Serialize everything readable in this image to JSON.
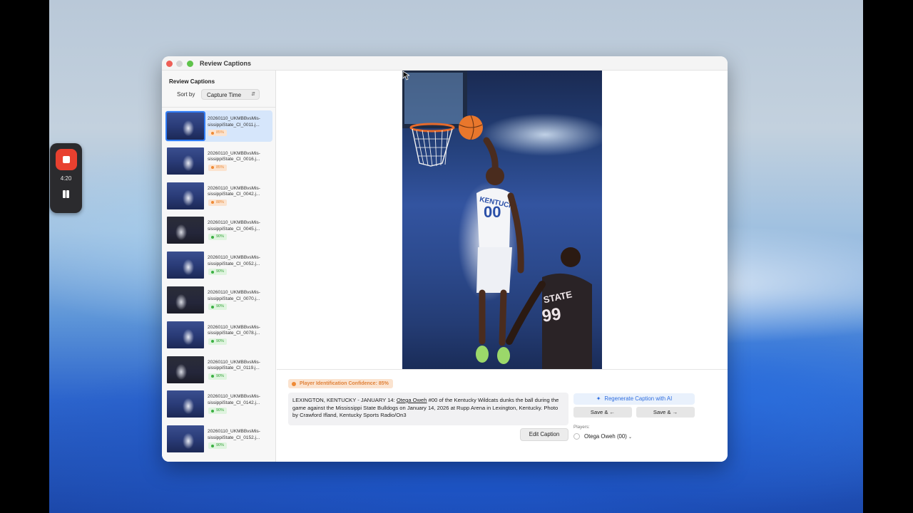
{
  "recorder": {
    "time": "4:20"
  },
  "window": {
    "title": "Review Captions"
  },
  "sidebar": {
    "heading": "Review Captions",
    "sort_label": "Sort by",
    "sort_value": "Capture Time",
    "items": [
      {
        "line1": "20260110_UKMBBvsMis-",
        "line2": "sissippiState_CI_0011.j...",
        "confidence": "85%",
        "level": "orange",
        "selected": true
      },
      {
        "line1": "20260110_UKMBBvsMis-",
        "line2": "sissippiState_CI_0016.j...",
        "confidence": "85%",
        "level": "orange"
      },
      {
        "line1": "20260110_UKMBBvsMis-",
        "line2": "sissippiState_CI_0042.j...",
        "confidence": "88%",
        "level": "orange"
      },
      {
        "line1": "20260110_UKMBBvsMis-",
        "line2": "sissippiState_CI_0045.j...",
        "confidence": "90%",
        "level": "green"
      },
      {
        "line1": "20260110_UKMBBvsMis-",
        "line2": "sissippiState_CI_0052.j...",
        "confidence": "90%",
        "level": "green"
      },
      {
        "line1": "20260110_UKMBBvsMis-",
        "line2": "sissippiState_CI_0070.j...",
        "confidence": "90%",
        "level": "green"
      },
      {
        "line1": "20260110_UKMBBvsMis-",
        "line2": "sissippiState_CI_0078.j...",
        "confidence": "90%",
        "level": "green"
      },
      {
        "line1": "20260110_UKMBBvsMis-",
        "line2": "sissippiState_CI_0119.j...",
        "confidence": "90%",
        "level": "green"
      },
      {
        "line1": "20260110_UKMBBvsMis-",
        "line2": "sissippiState_CI_0142.j...",
        "confidence": "90%",
        "level": "green"
      },
      {
        "line1": "20260110_UKMBBvsMis-",
        "line2": "sissippiState_CI_0152.j...",
        "confidence": "90%",
        "level": "green"
      }
    ]
  },
  "main": {
    "confidence_pill": "Player Identification Confidence: 85%",
    "caption": {
      "before": "LEXINGTON, KENTUCKY - JANUARY 14: ",
      "player_name": "Otega Oweh",
      "after": " #00 of the Kentucky Wildcats dunks the ball during the game against the Mississippi State Bulldogs on January 14, 2026 at Rupp Arena in Lexington, Kentucky. Photo by Crawford Ifland, Kentucky Sports Radio/On3"
    },
    "edit_button": "Edit Caption",
    "regenerate_button": "Regenerate Caption with AI",
    "save_prev_button": "Save & ←",
    "save_next_button": "Save & →",
    "players_label": "Players:",
    "player": "Otega Oweh (00)",
    "photo": {
      "jersey_front_text": "KENTUCKY",
      "jersey_front_number": "00",
      "jersey_back_text": "STATE",
      "jersey_back_number": "99"
    }
  },
  "colors": {
    "accent": "#2f7cf6",
    "confidence_orange": "#ef8a35",
    "confidence_green": "#3bb043",
    "record_red": "#e8402f"
  }
}
